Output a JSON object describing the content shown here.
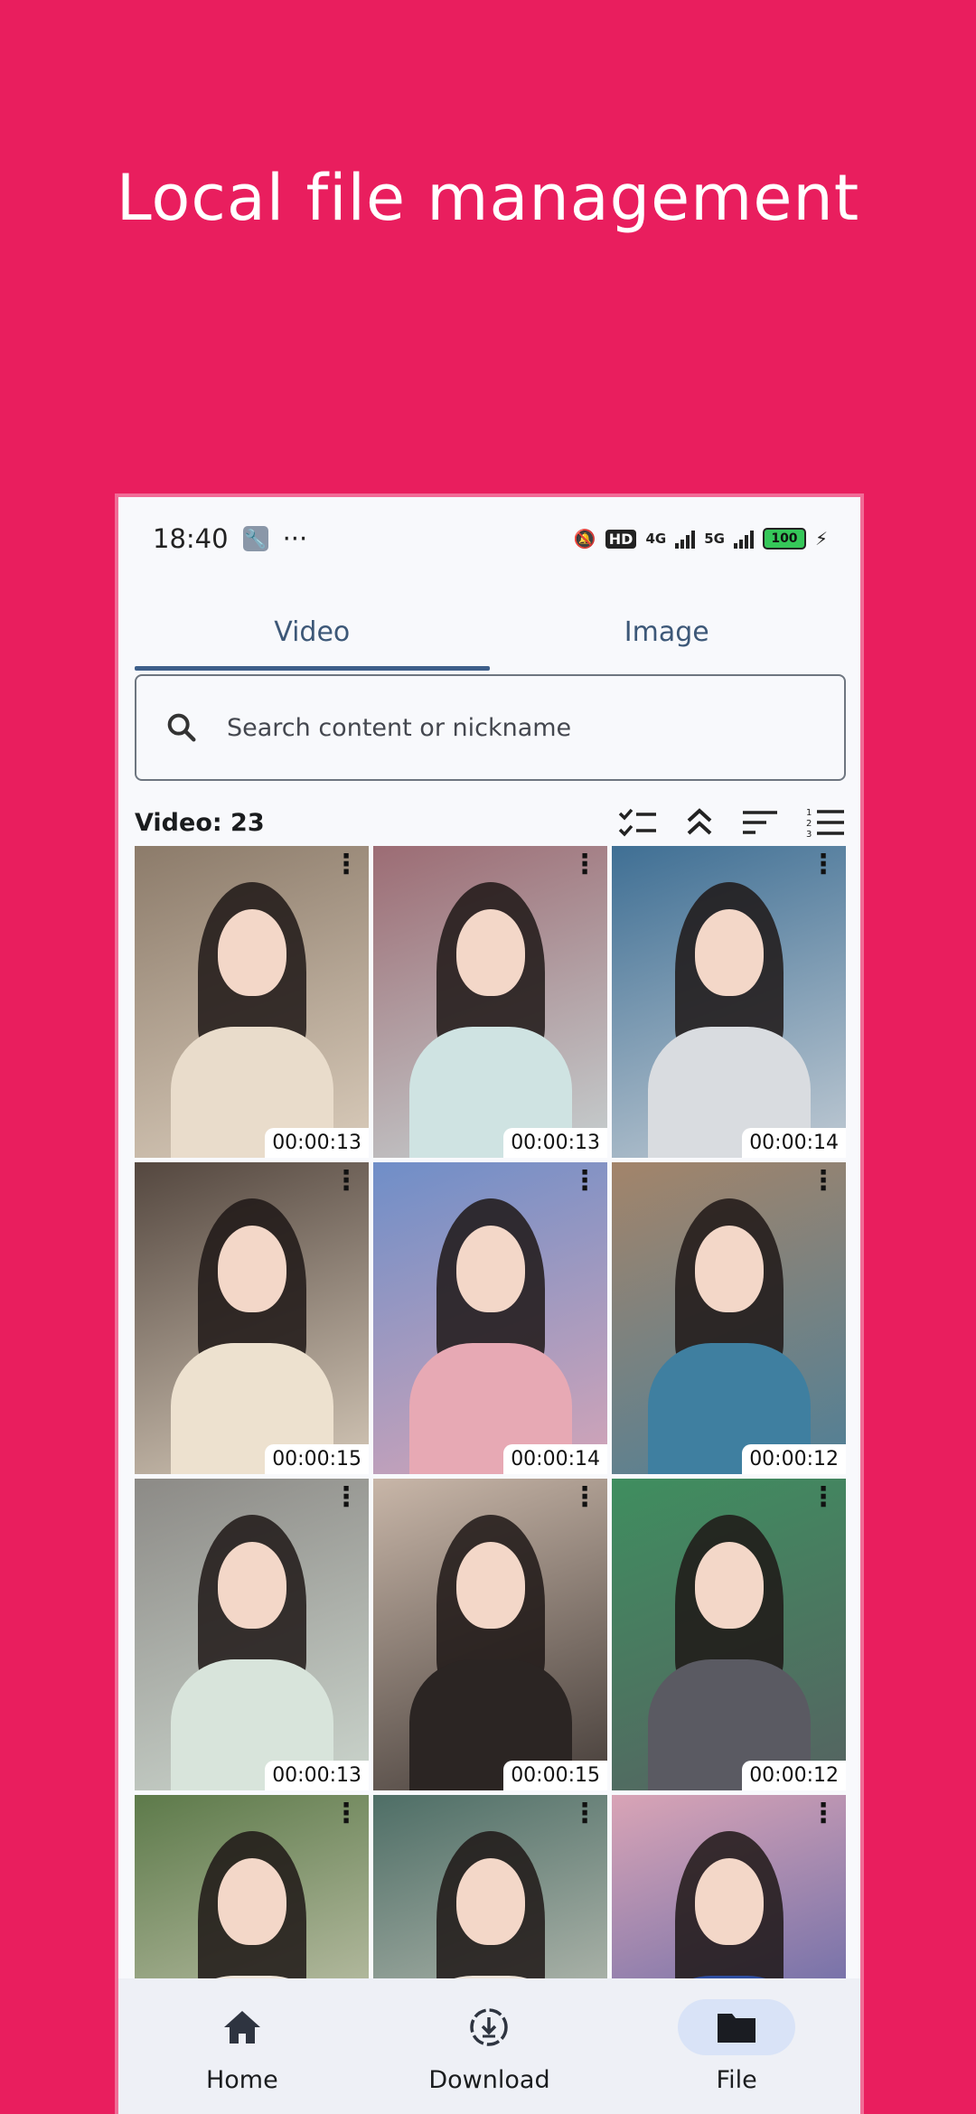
{
  "promo": {
    "title": "Local file management"
  },
  "status_bar": {
    "time": "18:40",
    "dots": "···",
    "hd": "HD",
    "net1": "4G",
    "net2": "5G",
    "battery": "100"
  },
  "tabs": [
    {
      "label": "Video",
      "active": true
    },
    {
      "label": "Image",
      "active": false
    }
  ],
  "search": {
    "placeholder": "Search content or nickname",
    "icon": "search-icon"
  },
  "toolbar": {
    "count_label": "Video: 23",
    "icons": [
      "checklist-icon",
      "collapse-icon",
      "sort-icon",
      "numbered-list-icon"
    ]
  },
  "videos": [
    {
      "duration": "00:00:13",
      "bg": "#8C7B6A",
      "fg": "#E9DCCB"
    },
    {
      "duration": "00:00:13",
      "bg": "#9C6C74",
      "fg": "#CFE3E2"
    },
    {
      "duration": "00:00:14",
      "bg": "#3F6F94",
      "fg": "#D9DCE0"
    },
    {
      "duration": "00:00:15",
      "bg": "#54473F",
      "fg": "#EDE1CF"
    },
    {
      "duration": "00:00:14",
      "bg": "#6F8EC8",
      "fg": "#E7A9B4"
    },
    {
      "duration": "00:00:12",
      "bg": "#A3846A",
      "fg": "#3F7FA0"
    },
    {
      "duration": "00:00:13",
      "bg": "#8C8A86",
      "fg": "#D8E4DB"
    },
    {
      "duration": "00:00:15",
      "bg": "#C8B6A8",
      "fg": "#2B2523"
    },
    {
      "duration": "00:00:12",
      "bg": "#3F8E5F",
      "fg": "#5A5A62"
    },
    {
      "duration": "",
      "bg": "#5D7A4A",
      "fg": "#F0E6DA"
    },
    {
      "duration": "",
      "bg": "#4E6E66",
      "fg": "#EDE3D8"
    },
    {
      "duration": "",
      "bg": "#D9A4B6",
      "fg": "#2E4DA0"
    }
  ],
  "bottom_nav": [
    {
      "label": "Home",
      "icon": "home-icon",
      "active": false
    },
    {
      "label": "Download",
      "icon": "download-icon",
      "active": false
    },
    {
      "label": "File",
      "icon": "folder-icon",
      "active": true
    }
  ]
}
